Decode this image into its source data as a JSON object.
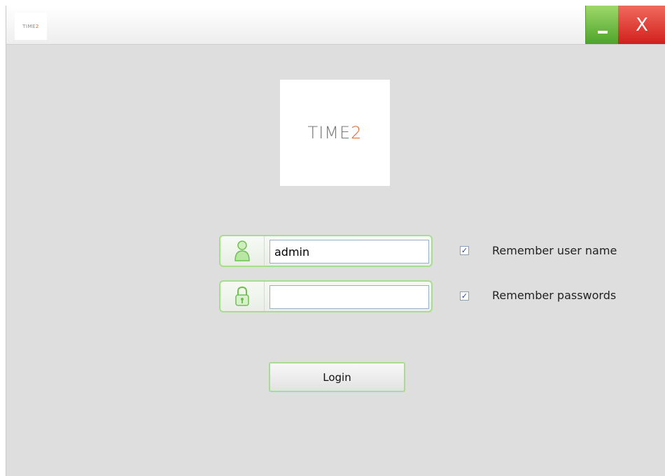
{
  "window": {
    "brand_main": "TIME",
    "brand_digit": "2",
    "close_label": "X"
  },
  "logo": {
    "main": "TIME",
    "digit": "2"
  },
  "login_form": {
    "username_value": "admin",
    "password_value": "",
    "remember_user_label": "Remember user name",
    "remember_user_checked": true,
    "remember_password_label": "Remember passwords",
    "remember_password_checked": true,
    "login_label": "Login"
  },
  "icons": {
    "username": "user-icon",
    "password": "padlock-icon",
    "minimize": "minimize-icon"
  },
  "colors": {
    "accent_green": "#a6de8e",
    "close_red": "#d1201b",
    "brand_orange": "#e8662f"
  }
}
